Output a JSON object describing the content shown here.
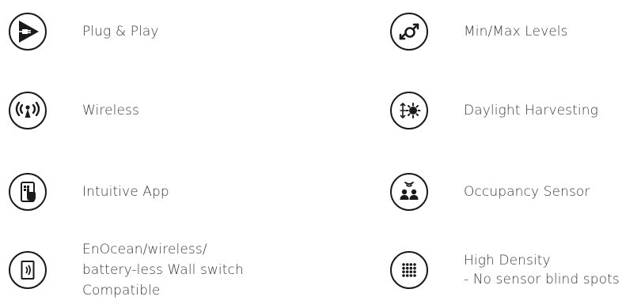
{
  "features_left": [
    {
      "icon": "plug-play-icon",
      "lines": [
        "Plug & Play"
      ]
    },
    {
      "icon": "wireless-icon",
      "lines": [
        "Wireless"
      ]
    },
    {
      "icon": "intuitive-app-icon",
      "lines": [
        "Intuitive App"
      ]
    },
    {
      "icon": "wall-switch-icon",
      "lines": [
        "EnOcean/wireless/",
        "battery-less Wall switch",
        "Compatible"
      ]
    }
  ],
  "features_right": [
    {
      "icon": "min-max-levels-icon",
      "lines": [
        "Min/Max Levels"
      ]
    },
    {
      "icon": "daylight-harvesting-icon",
      "lines": [
        "Daylight Harvesting"
      ]
    },
    {
      "icon": "occupancy-sensor-icon",
      "lines": [
        "Occupancy Sensor"
      ]
    },
    {
      "icon": "high-density-icon",
      "lines": [
        "High Density",
        "- No sensor blind spots"
      ]
    }
  ],
  "colors": {
    "icon_stroke": "#1a1a1a",
    "text": "#3a3a3a",
    "background": "#ffffff"
  }
}
